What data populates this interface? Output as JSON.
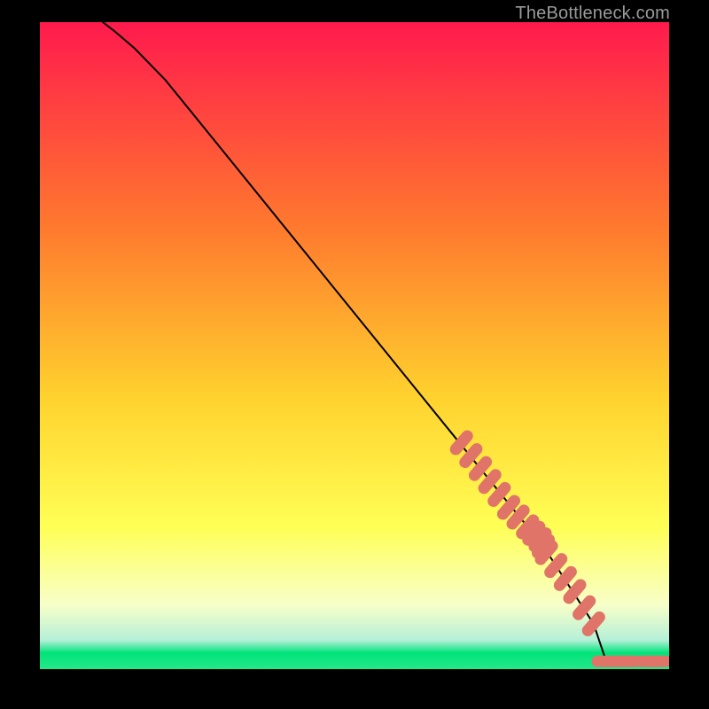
{
  "attribution": "TheBottleneck.com",
  "colors": {
    "bg_black": "#000000",
    "grad_top": "#ff1a4d",
    "grad_mid1": "#ff7a2e",
    "grad_mid2": "#ffd22e",
    "grad_mid3": "#ffff55",
    "grad_mid4": "#f6ffbf",
    "grad_green": "#00e37a",
    "grad_cyan": "#9beee0",
    "curve": "#000000",
    "marker": "#e07468",
    "attribution": "#9a9a9a"
  },
  "chart_data": {
    "type": "line",
    "title": "",
    "xlabel": "",
    "ylabel": "",
    "xlim": [
      0,
      100
    ],
    "ylim": [
      0,
      100
    ],
    "series": [
      {
        "name": "curve",
        "x": [
          10,
          12,
          15,
          20,
          30,
          40,
          50,
          60,
          70,
          80,
          88,
          90,
          95,
          100
        ],
        "y": [
          100,
          98.5,
          96,
          91,
          79,
          67,
          55,
          43,
          31,
          19,
          7,
          1.2,
          1.2,
          1.2
        ]
      }
    ],
    "markers": {
      "name": "highlighted-points",
      "x": [
        67,
        68.5,
        70,
        71.5,
        73,
        74.5,
        76,
        77.5,
        78.5,
        79.5,
        80,
        80.5,
        82,
        83.5,
        85,
        86.5,
        88,
        90,
        92.5,
        93.5,
        97,
        98
      ],
      "y": [
        35,
        33,
        31,
        29,
        27,
        25,
        23.5,
        22,
        21,
        20,
        19,
        18,
        16,
        14,
        12,
        9.5,
        7,
        1.2,
        1.2,
        1.2,
        1.2,
        1.2
      ]
    },
    "gradient_bands": [
      {
        "from": 100,
        "to": 60,
        "c0": "grad_top",
        "c1": "grad_mid1"
      },
      {
        "from": 60,
        "to": 30,
        "c0": "grad_mid1",
        "c1": "grad_mid2"
      },
      {
        "from": 30,
        "to": 15,
        "c0": "grad_mid2",
        "c1": "grad_mid3"
      },
      {
        "from": 15,
        "to": 6,
        "c0": "grad_mid3",
        "c1": "grad_mid4"
      },
      {
        "from": 6,
        "to": 2.2,
        "c0": "grad_mid4",
        "c1": "grad_cyan"
      },
      {
        "from": 2.2,
        "to": 0,
        "c0": "grad_green",
        "c1": "grad_green"
      }
    ]
  }
}
